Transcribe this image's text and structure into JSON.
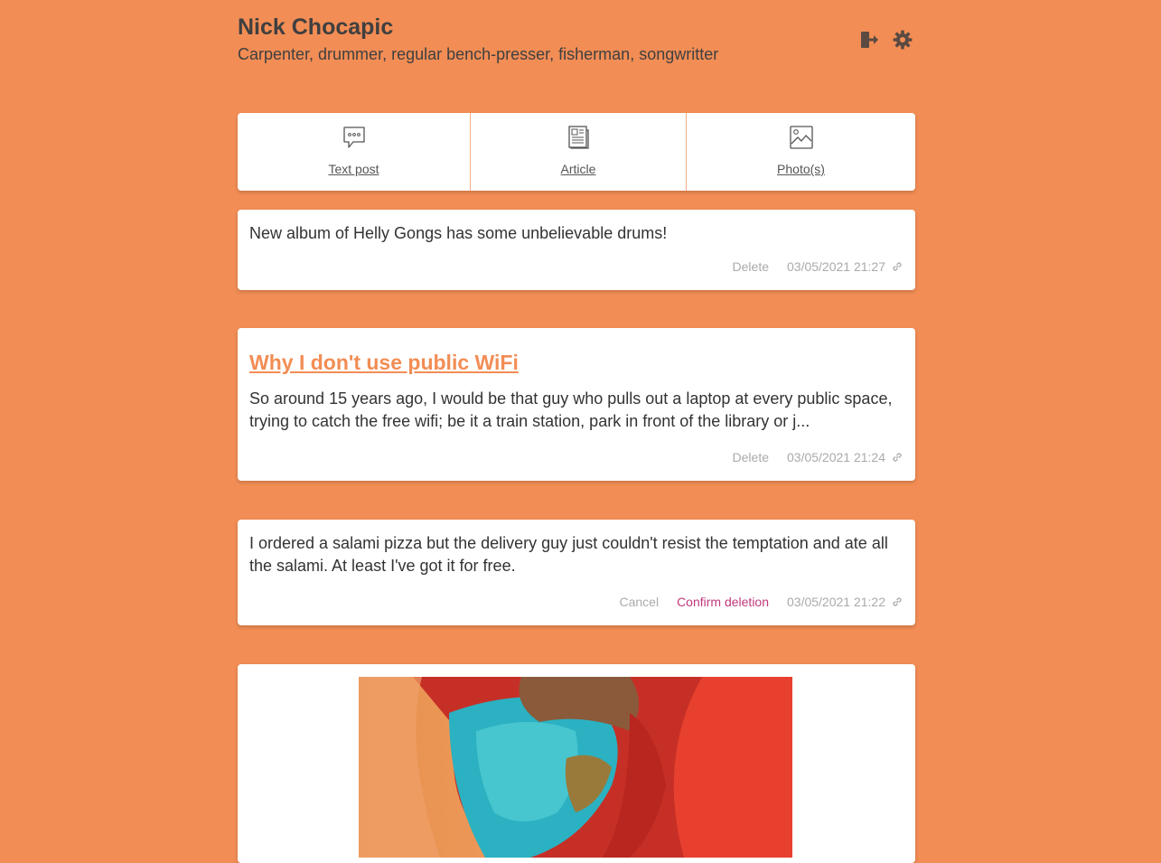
{
  "profile": {
    "name": "Nick Chocapic",
    "bio": "Carpenter, drummer, regular bench-presser, fisherman, songwritter",
    "actions": [
      {
        "icon": "logout-icon"
      },
      {
        "icon": "gear-icon"
      }
    ]
  },
  "composer": {
    "tabs": [
      {
        "label": "Text post",
        "icon": "chat-bubble-icon"
      },
      {
        "label": "Article",
        "icon": "newspaper-icon"
      },
      {
        "label": "Photo(s)",
        "icon": "image-icon"
      }
    ]
  },
  "posts": [
    {
      "type": "text",
      "text": "New album of Helly Gongs has some unbelievable drums!",
      "delete_label": "Delete",
      "date": "03/05/2021 21:27"
    },
    {
      "type": "article",
      "title": "Why I don't use public WiFi",
      "excerpt": "So around 15 years ago, I would be that guy who pulls out a laptop at every public space, trying to catch the free wifi; be it a train station, park in front of the library or j...",
      "delete_label": "Delete",
      "date": "03/05/2021 21:24"
    },
    {
      "type": "text",
      "text": "I ordered a salami pizza but the delivery guy just couldn't resist the temptation and ate all the salami. At least I've got it for free.",
      "cancel_label": "Cancel",
      "confirm_label": "Confirm deletion",
      "date": "03/05/2021 21:22"
    },
    {
      "type": "photo"
    }
  ],
  "colors": {
    "background": "#f28d55",
    "accent": "#f28d55",
    "danger": "#c0397d",
    "muted": "#aaaaaa"
  }
}
